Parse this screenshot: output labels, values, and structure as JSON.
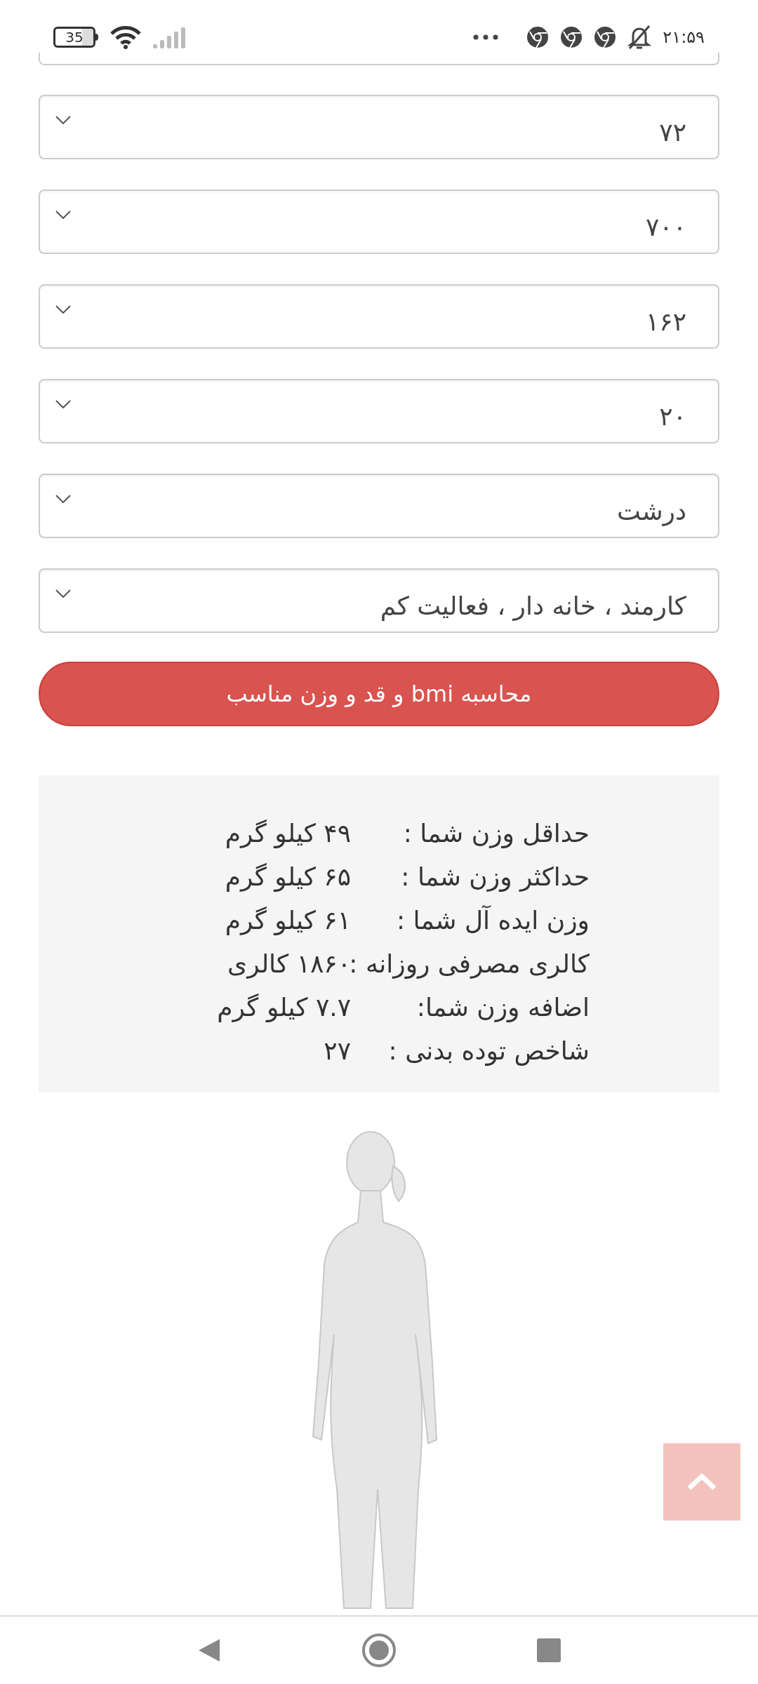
{
  "status_bar": {
    "battery": "35",
    "time": "۲۱:۵۹"
  },
  "selects": [
    {
      "value": "۷۲"
    },
    {
      "value": "۷۰۰"
    },
    {
      "value": "۱۶۲"
    },
    {
      "value": "۲۰"
    },
    {
      "value": "درشت"
    },
    {
      "value": "کارمند ، خانه دار ، فعالیت کم"
    }
  ],
  "submit_button": "محاسبه bmi و قد و وزن مناسب",
  "results": [
    {
      "label": "حداقل وزن شما :",
      "value": "۴۹ کیلو گرم"
    },
    {
      "label": "حداکثر وزن شما :",
      "value": "۶۵ کیلو گرم"
    },
    {
      "label": "وزن ایده آل شما :",
      "value": "۶۱ کیلو گرم"
    },
    {
      "label": "کالری مصرفی روزانه :",
      "value": "۱۸۶۰ کالری"
    },
    {
      "label": "اضافه وزن شما:",
      "value": "۷.۷ کیلو گرم"
    },
    {
      "label": "شاخص توده بدنی :",
      "value": "۲۷"
    }
  ]
}
